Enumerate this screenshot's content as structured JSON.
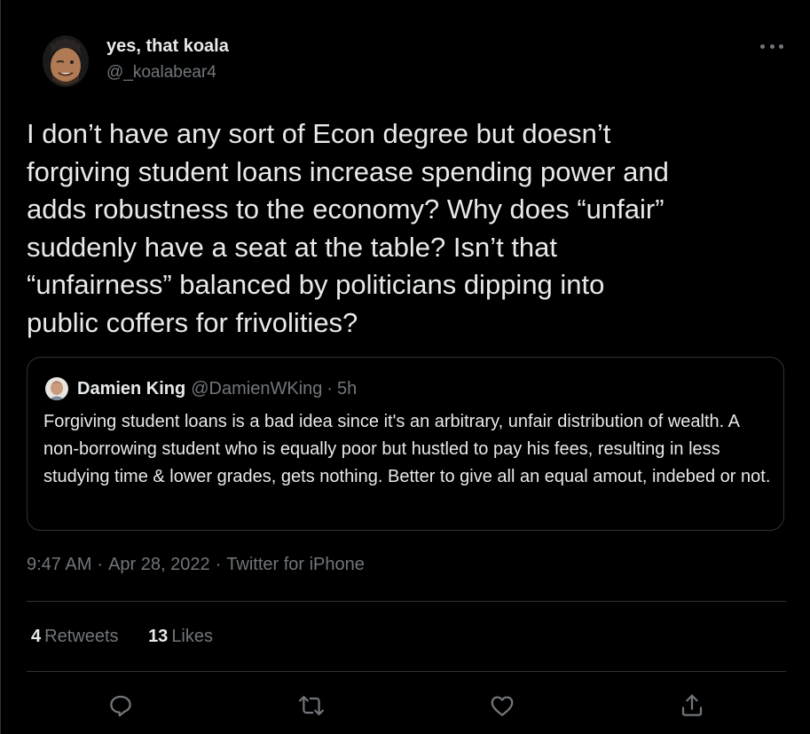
{
  "author": {
    "name": "yes, that koala",
    "handle": "@_koalabear4"
  },
  "tweet": {
    "text": "I don’t have any sort of Econ degree but doesn’t\nforgiving student loans increase spending power and\nadds robustness to the economy? Why does “unfair”\nsuddenly have a seat at the table? Isn’t that\n“unfairness” balanced by  politicians dipping into\npublic coffers for frivolities?"
  },
  "quote": {
    "name": "Damien King",
    "handle": "@DamienWKing",
    "separator": "·",
    "time": "5h",
    "text": "Forgiving student loans is a bad idea since it's an arbitrary, unfair distribution of wealth. A non-borrowing student who is equally poor but hustled to pay his fees, resulting in less studying time & lower grades, gets nothing. Better to give all an equal amout, indebed or not."
  },
  "meta": {
    "time": "9:47 AM",
    "date": "Apr 28, 2022",
    "source": "Twitter for iPhone",
    "separator": "·"
  },
  "stats": {
    "retweets_count": "4",
    "retweets_label": "Retweets",
    "likes_count": "13",
    "likes_label": "Likes"
  },
  "actions": {
    "reply_icon": "reply-icon",
    "retweet_icon": "retweet-icon",
    "like_icon": "heart-icon",
    "share_icon": "share-icon"
  },
  "colors": {
    "background": "#000000",
    "text_primary": "#e7e9ea",
    "text_secondary": "#71767b",
    "border": "#2f3336"
  }
}
